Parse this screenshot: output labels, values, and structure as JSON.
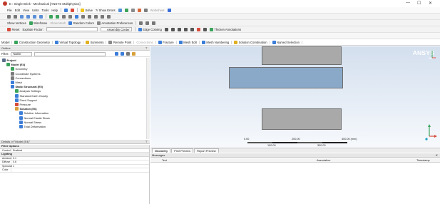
{
  "window": {
    "title": "E : Single Brick - Mechanical [ANSYS Multiphysics]",
    "controls": [
      "—",
      "☐",
      "✕"
    ]
  },
  "menubar": {
    "items": [
      "File",
      "Edit",
      "View",
      "Units",
      "Tools",
      "Help"
    ],
    "solve_label": "Solve",
    "show_errors_label": "?/ Show Errors",
    "worksheet_label": "Worksheet"
  },
  "toolbar3": {
    "show_vertices": "Show Vertices",
    "wireframe": "Wireframe",
    "show_mesh": "Show Mesh",
    "random_colors": "Random Colors",
    "annotation_prefs": "Annotation Preferences"
  },
  "toolbar4": {
    "reset": "Reset",
    "explode_factor": "Explode Factor:",
    "assembly_center": "Assembly Center",
    "edge_coloring": "Edge Coloring",
    "thicken": "Thicken Annotations"
  },
  "context_toolbar": {
    "items": [
      "Model",
      "Construction Geometry",
      "Virtual Topology",
      "Symmetry",
      "Remote Point",
      "Connections",
      "Fracture",
      "Mesh Edit",
      "Mesh Numbering",
      "Solution Combination",
      "Named Selection"
    ]
  },
  "outline": {
    "title": "Outline",
    "filter_label": "Filter:",
    "filter_value": "Name",
    "tree": [
      {
        "label": "Project",
        "level": 0,
        "bold": true
      },
      {
        "label": "Model (E4)",
        "level": 1,
        "bold": true
      },
      {
        "label": "Geometry",
        "level": 2
      },
      {
        "label": "Coordinate Systems",
        "level": 2
      },
      {
        "label": "Connections",
        "level": 2
      },
      {
        "label": "Mesh",
        "level": 2
      },
      {
        "label": "Static Structural (E5)",
        "level": 2,
        "bold": true
      },
      {
        "label": "Analysis Settings",
        "level": 3
      },
      {
        "label": "Standard Earth Gravity",
        "level": 3
      },
      {
        "label": "Fixed Support",
        "level": 3
      },
      {
        "label": "Pressure",
        "level": 3
      },
      {
        "label": "Solution (E6)",
        "level": 3,
        "bold": true
      },
      {
        "label": "Solution Information",
        "level": 4
      },
      {
        "label": "Normal Elastic Strain",
        "level": 4
      },
      {
        "label": "Normal Stress",
        "level": 4
      },
      {
        "label": "Total Deformation",
        "level": 4
      }
    ]
  },
  "details": {
    "title": "Details of \"Model (E4)\"",
    "groups": [
      {
        "name": "Filter Options",
        "rows": [
          {
            "k": "Control",
            "v": "Enabled"
          }
        ]
      },
      {
        "name": "Lighting",
        "rows": [
          {
            "k": "Ambient",
            "v": "0.1"
          },
          {
            "k": "Diffuse",
            "v": "0.6"
          },
          {
            "k": "Specular",
            "v": "1"
          },
          {
            "k": "Color",
            "v": ""
          }
        ]
      }
    ]
  },
  "viewport": {
    "logo_name": "ANSYS",
    "logo_version": "16.0",
    "scale": {
      "top_labels": [
        "0.00",
        "200.00",
        "400.00 (mm)"
      ],
      "bottom_labels": [
        "100.00",
        "300.00"
      ]
    },
    "colors": {
      "brick": "#a9a9a9",
      "middle_brick": "#8aa9c8",
      "bg_top": "#d3dfee"
    }
  },
  "view_tabs": [
    "Geometry",
    "Print Preview",
    "Report Preview"
  ],
  "messages": {
    "title": "Messages",
    "columns": [
      "Text",
      "Association",
      "Timestamp"
    ]
  }
}
